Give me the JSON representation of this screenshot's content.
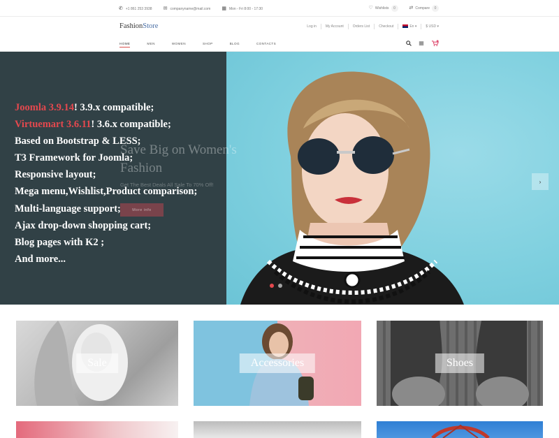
{
  "topbar": {
    "phone": "+1 861 253 3938",
    "email": "companyname@mail.com",
    "hours": "Mon - Fri 8:00 - 17:30",
    "wishlist_label": "Wishlists",
    "wishlist_count": "0",
    "compare_label": "Compare",
    "compare_count": "0"
  },
  "header": {
    "logo_part1": "Fashion",
    "logo_part2": "Store",
    "login": "Log in",
    "my_account": "My Account",
    "orders_list": "Orders List",
    "checkout": "Checkout",
    "language": "En",
    "currency": "$ USD"
  },
  "nav": {
    "items": [
      "HOME",
      "MEN",
      "WOMEN",
      "SHOP",
      "BLOG",
      "CONTACTS"
    ],
    "active_index": 0
  },
  "hero": {
    "slide_title": "Save Big on Women's Fashion",
    "slide_subtitle": "Get The Best Deals All Sale To 70% Off!",
    "slide_button": "More info",
    "features": [
      {
        "highlight": "Joomla 3.9.14",
        "rest": "! 3.9.x compatible;"
      },
      {
        "highlight": "Virtuemart 3.6.11",
        "rest": "! 3.6.x compatible;"
      },
      {
        "highlight": "",
        "rest": "Based on Bootstrap & LESS;"
      },
      {
        "highlight": "",
        "rest": "T3 Framework for Joomla;"
      },
      {
        "highlight": "",
        "rest": "Responsive layout;"
      },
      {
        "highlight": "",
        "rest": "Mega menu,Wishlist,Product comparison;"
      },
      {
        "highlight": "",
        "rest": "Multi-language support;"
      },
      {
        "highlight": "",
        "rest": "Ajax drop-down shopping cart;"
      },
      {
        "highlight": "",
        "rest": "Blog pages with K2 ;"
      },
      {
        "highlight": "",
        "rest": "And more..."
      }
    ],
    "next_arrow": "›",
    "active_dot": 0
  },
  "categories": [
    {
      "label": "Sale"
    },
    {
      "label": "Accessories"
    },
    {
      "label": "Shoes"
    }
  ],
  "colors": {
    "accent_red": "#e4484e",
    "logo_blue": "#4a6fa5",
    "overlay": "#282e30"
  }
}
